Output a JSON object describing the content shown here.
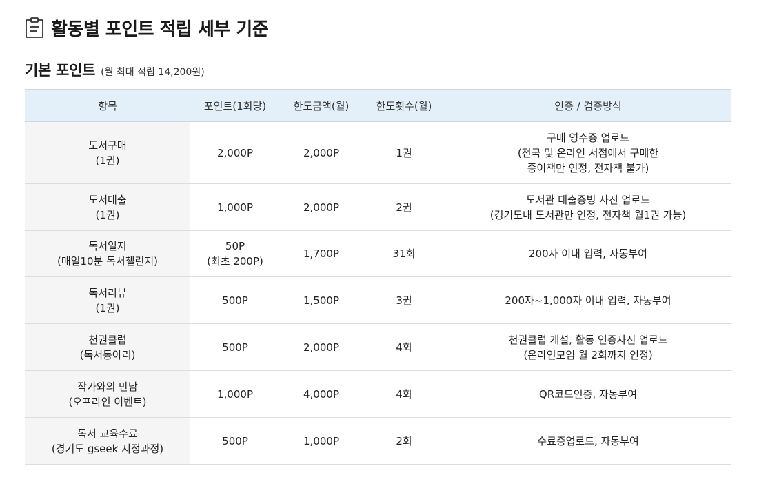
{
  "page": {
    "title": "활동별 포인트 적립 세부 기준",
    "title_icon": "clipboard-icon"
  },
  "section": {
    "title": "기본 포인트",
    "note": "(월 최대 적립 14,200원)"
  },
  "table": {
    "headers": [
      "항목",
      "포인트(1회당)",
      "한도금액(월)",
      "한도횟수(월)",
      "인증 / 검증방식"
    ],
    "rows": [
      {
        "item": [
          "도서구매",
          "(1권)"
        ],
        "point": [
          "2,000P"
        ],
        "limit_amount": "2,000P",
        "limit_count": "1권",
        "verification": [
          "구매 영수증 업로드",
          "(전국 및 온라인 서점에서 구매한",
          "종이책만 인정, 전자책 불가)"
        ]
      },
      {
        "item": [
          "도서대출",
          "(1권)"
        ],
        "point": [
          "1,000P"
        ],
        "limit_amount": "2,000P",
        "limit_count": "2권",
        "verification": [
          "도서관 대출증빙 사진 업로드",
          "(경기도내 도서관만 인정, 전자책 월1권 가능)"
        ]
      },
      {
        "item": [
          "독서일지",
          "(매일10분 독서챌린지)"
        ],
        "point": [
          "50P",
          "(최초 200P)"
        ],
        "limit_amount": "1,700P",
        "limit_count": "31회",
        "verification": [
          "200자 이내 입력, 자동부여"
        ]
      },
      {
        "item": [
          "독서리뷰",
          "(1권)"
        ],
        "point": [
          "500P"
        ],
        "limit_amount": "1,500P",
        "limit_count": "3권",
        "verification": [
          "200자~1,000자 이내 입력, 자동부여"
        ]
      },
      {
        "item": [
          "천권클럽",
          "(독서동아리)"
        ],
        "point": [
          "500P"
        ],
        "limit_amount": "2,000P",
        "limit_count": "4회",
        "verification": [
          "천권클럽 개설, 활동 인증사진 업로드",
          "(온라인모임 월 2회까지 인정)"
        ]
      },
      {
        "item": [
          "작가와의 만남",
          "(오프라인 이벤트)"
        ],
        "point": [
          "1,000P"
        ],
        "limit_amount": "4,000P",
        "limit_count": "4회",
        "verification": [
          "QR코드인증, 자동부여"
        ]
      },
      {
        "item": [
          "독서 교육수료",
          "(경기도 gseek 지정과정)"
        ],
        "point": [
          "500P"
        ],
        "limit_amount": "1,000P",
        "limit_count": "2회",
        "verification": [
          "수료증업로드, 자동부여"
        ]
      }
    ]
  }
}
